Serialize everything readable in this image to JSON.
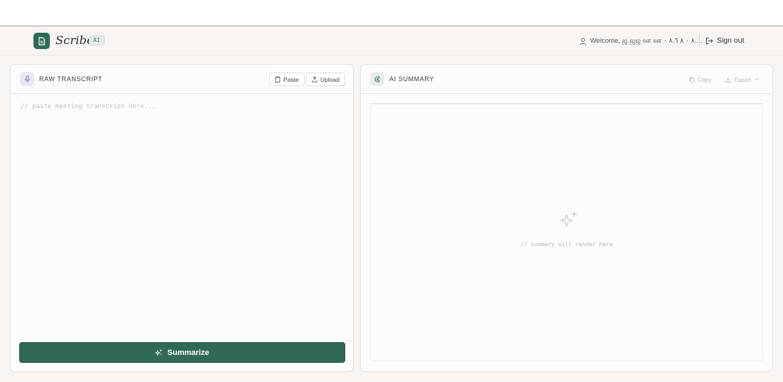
{
  "header": {
    "brand": "Scribe",
    "badge": "AI",
    "welcome_text": "Welcome, ஜ.ஜஜ ஊ ஊ ۰ ٨ ٠ ٨ ٨.٦....",
    "signout_label": "Sign out"
  },
  "transcript_panel": {
    "title": "RAW TRANSCRIPT",
    "paste_label": "Paste",
    "upload_label": "Upload",
    "placeholder": "// paste meeting transcript here...",
    "summarize_label": "Summarize"
  },
  "summary_panel": {
    "title": "AI SUMMARY",
    "copy_label": "Copy",
    "export_label": "Export",
    "empty_text": "// summary will render here"
  },
  "colors": {
    "accent": "#306a55",
    "background": "#f7f4f2",
    "panel": "#fdfcfc"
  },
  "icons": [
    "document-icon",
    "user-icon",
    "sign-out-icon",
    "microphone-icon",
    "clipboard-icon",
    "upload-icon",
    "ai-logo-icon",
    "copy-icon",
    "download-icon",
    "chevron-down-icon",
    "sparkles-icon"
  ]
}
